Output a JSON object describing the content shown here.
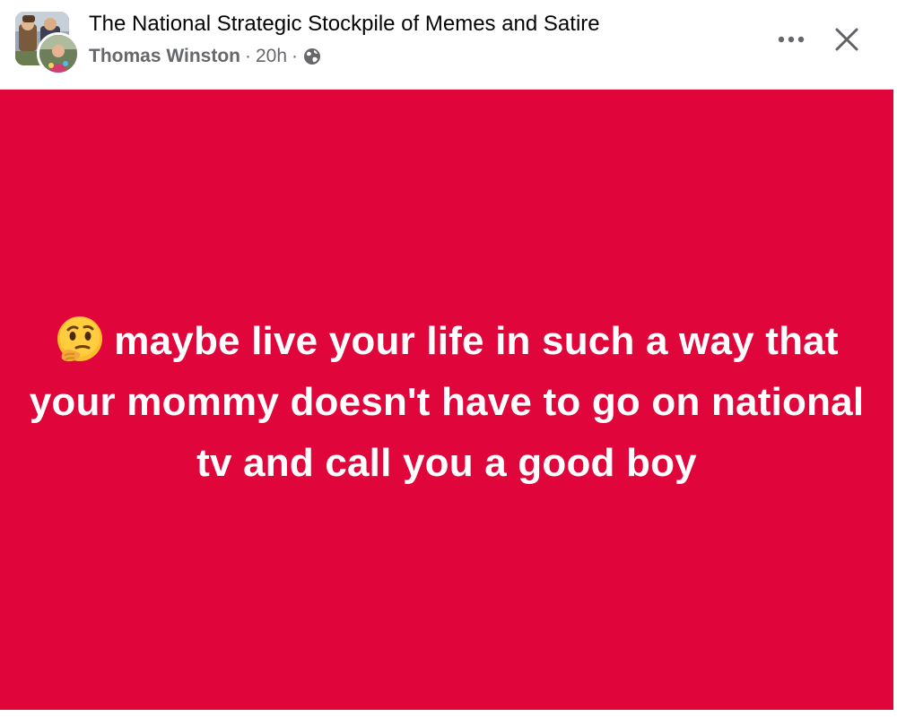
{
  "post": {
    "group_name": "The National Strategic Stockpile of Memes and Satire",
    "author": "Thomas Winston",
    "time": "20h",
    "separator": "·",
    "privacy_icon": "globe-icon",
    "actions": {
      "more_icon": "more-options-icon",
      "close_icon": "close-icon"
    },
    "body": {
      "background_color": "#e0053a",
      "text_color": "#ffffff",
      "emoji": "thinking-face-icon",
      "text": "maybe live your life in such a way that your mommy doesn't have to go on national tv and call you a good boy"
    }
  }
}
